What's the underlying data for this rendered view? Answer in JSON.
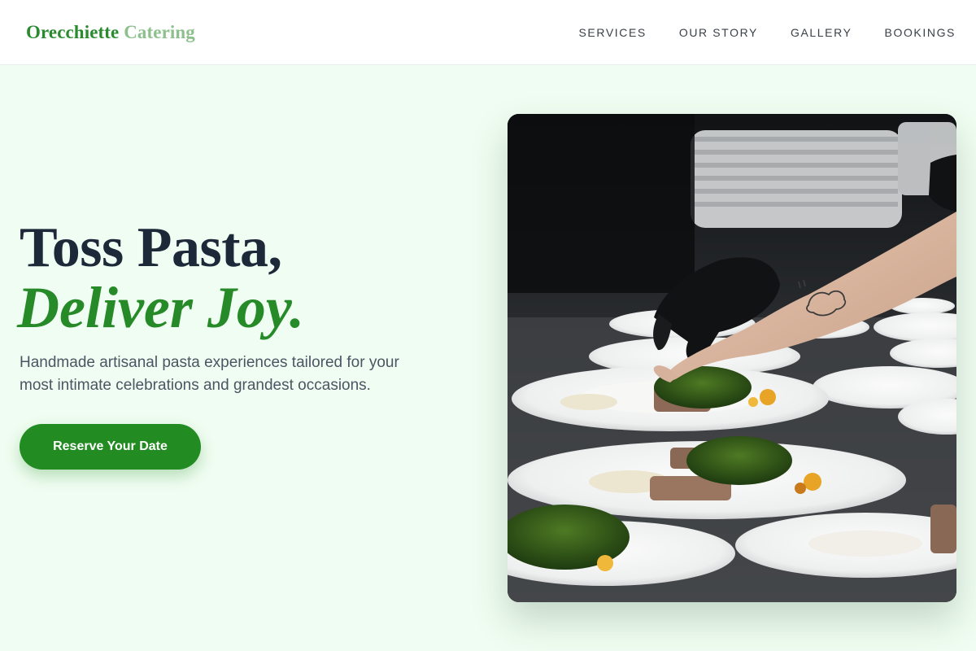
{
  "header": {
    "logo_part1": "Orecchiette",
    "logo_part2": "Catering",
    "nav": [
      {
        "label": "SERVICES"
      },
      {
        "label": "OUR STORY"
      },
      {
        "label": "GALLERY"
      },
      {
        "label": "BOOKINGS"
      }
    ]
  },
  "hero": {
    "headline": "Toss Pasta,",
    "headline_accent": "Deliver Joy.",
    "subtitle": "Handmade artisanal pasta experiences tailored for your most intimate celebrations and grandest occasions.",
    "cta_label": "Reserve Your Date",
    "image_alt": "Chef plating dishes with greens on white plates"
  },
  "colors": {
    "accent": "#228b22",
    "logo_secondary": "#8ec08e",
    "background": "#f0fdf2",
    "heading": "#1d2939"
  }
}
